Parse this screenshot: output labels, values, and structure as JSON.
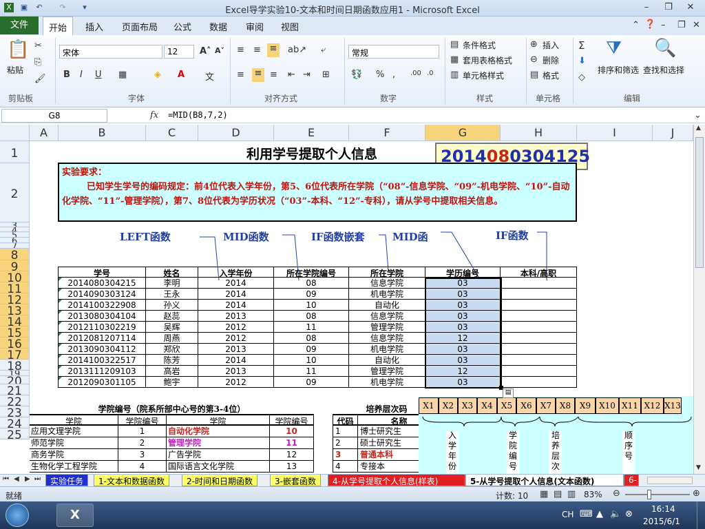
{
  "window": {
    "title": "Excel导学实验10-文本和时间日期函数应用1 - Microsoft Excel"
  },
  "tabs": [
    "文件",
    "开始",
    "插入",
    "页面布局",
    "公式",
    "数据",
    "审阅",
    "视图"
  ],
  "ribbon": {
    "paste": "粘贴",
    "font_name": "宋体",
    "font_size": "12",
    "number_format": "常规",
    "cond_format": "条件格式",
    "table_format": "套用表格格式",
    "cell_style": "单元格样式",
    "insert": "插入",
    "delete": "删除",
    "format": "格式",
    "sort_filter": "排序和筛选",
    "find_select": "查找和选择",
    "groups": [
      "剪贴板",
      "字体",
      "对齐方式",
      "数字",
      "样式",
      "单元格",
      "编辑"
    ]
  },
  "formula_bar": {
    "name_box": "G8",
    "fx": "fx",
    "formula": "=MID(B8,7,2)"
  },
  "columns": [
    "A",
    "B",
    "C",
    "D",
    "E",
    "F",
    "G",
    "H",
    "I",
    "J"
  ],
  "rows": [
    "1",
    "2",
    "3",
    "4",
    "5",
    "6",
    "7",
    "8",
    "9",
    "10",
    "11",
    "12",
    "13",
    "14",
    "15",
    "16",
    "17",
    "18",
    "19",
    "20",
    "21",
    "22",
    "23",
    "24",
    "25"
  ],
  "sheet": {
    "title": "利用学号提取个人信息",
    "id_parts": [
      "2014",
      "08",
      "03",
      "04125"
    ],
    "req_title": "实验要求：",
    "req_body": "已知学生学号的编码规定：前4位代表入学年份，第5、6位代表所在学院（“08”-信息学院、“09”-机电学院、“10”-自动化学院、“11”-管理学院），第7、8位代表为学历状况（“03”-本科、“12”-专科），请从学号中提取相关信息。",
    "labels": [
      "LEFT函数",
      "MID函数",
      "IF函数嵌套",
      "MID函",
      "IF函数"
    ],
    "headers": [
      "学号",
      "姓名",
      "入学年份",
      "所在学院编号",
      "所在学院",
      "学历编号",
      "本科/高职"
    ],
    "records": [
      [
        "2014080304215",
        "李明",
        "2014",
        "08",
        "信息学院",
        "03",
        ""
      ],
      [
        "2014090303124",
        "王永",
        "2014",
        "09",
        "机电学院",
        "03",
        ""
      ],
      [
        "2014100322908",
        "孙义",
        "2014",
        "10",
        "自动化",
        "03",
        ""
      ],
      [
        "2013080304104",
        "赵蕊",
        "2013",
        "08",
        "信息学院",
        "03",
        ""
      ],
      [
        "2012110302219",
        "吴辉",
        "2012",
        "11",
        "管理学院",
        "03",
        ""
      ],
      [
        "2012081207114",
        "周燕",
        "2012",
        "08",
        "信息学院",
        "12",
        ""
      ],
      [
        "2013090304112",
        "郑欣",
        "2013",
        "09",
        "机电学院",
        "03",
        ""
      ],
      [
        "2014100322517",
        "陈芳",
        "2014",
        "10",
        "自动化",
        "03",
        ""
      ],
      [
        "2013111209103",
        "高岩",
        "2013",
        "11",
        "管理学院",
        "12",
        ""
      ],
      [
        "2012090301105",
        "鲍宇",
        "2012",
        "09",
        "机电学院",
        "03",
        ""
      ]
    ],
    "college_title": "学院编号（院系所部中心号的第3-4位）",
    "college_headers": [
      "学院",
      "学院编号",
      "学院",
      "学院编号"
    ],
    "college_rows": [
      [
        "应用文理学院",
        "1",
        "自动化学院",
        "10"
      ],
      [
        "师范学院",
        "2",
        "管理学院",
        "11"
      ],
      [
        "商务学院",
        "3",
        "广告学院",
        "12"
      ],
      [
        "生物化学工程学院",
        "4",
        "国际语言文化学院",
        "13"
      ]
    ],
    "level_title": "培养层次码",
    "level_headers": [
      "代码",
      "名称"
    ],
    "level_rows": [
      [
        "1",
        "博士研究生"
      ],
      [
        "2",
        "硕士研究生"
      ],
      [
        "3",
        "普通本科"
      ],
      [
        "4",
        "专接本"
      ]
    ],
    "xcells": [
      "X1",
      "X2",
      "X3",
      "X4",
      "X5",
      "X6",
      "X7",
      "X8",
      "X9",
      "X10",
      "X11",
      "X12",
      "X13"
    ],
    "xgroups": [
      "入学年份",
      "学院编号",
      "培养层次",
      "顺序号"
    ]
  },
  "sheet_tabs": [
    "实验任务",
    "1-文本和数据函数",
    "2-时间和日期函数",
    "3-嵌套函数",
    "4-从学号提取个人信息(样表)",
    "5-从学号提取个人信息(文本函数)",
    "6-"
  ],
  "status": {
    "ready": "就绪",
    "count": "计数: 10",
    "zoom": "83%"
  },
  "taskbar": {
    "ime": "CH",
    "time": "16:14",
    "date": "2015/6/1"
  }
}
